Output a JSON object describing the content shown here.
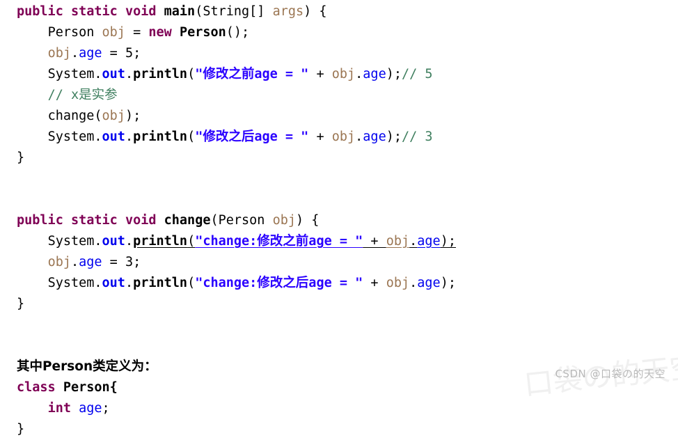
{
  "document": {
    "kind": "java-code-snippet",
    "background_color": "#ffffff"
  },
  "palette": {
    "keyword": "#7f0055",
    "plain": "#000000",
    "local_variable": "#9b7653",
    "field": "#0000ee",
    "string": "#2a00ff",
    "comment": "#3f7f5f",
    "watermark": "#b9b9b9",
    "watermark_faint": "#f0f0f0"
  },
  "code": {
    "lines": [
      {
        "id": "line-1",
        "indent": 0,
        "tokens": [
          {
            "t": "public",
            "c": "kw"
          },
          {
            "t": " ",
            "c": "plain"
          },
          {
            "t": "static",
            "c": "kw"
          },
          {
            "t": " ",
            "c": "plain"
          },
          {
            "t": "void",
            "c": "kw"
          },
          {
            "t": " ",
            "c": "plain"
          },
          {
            "t": "main",
            "c": "plainb"
          },
          {
            "t": "(",
            "c": "plain"
          },
          {
            "t": "String",
            "c": "plain"
          },
          {
            "t": "[] ",
            "c": "plain"
          },
          {
            "t": "args",
            "c": "var"
          },
          {
            "t": ") {",
            "c": "plain"
          }
        ]
      },
      {
        "id": "line-2",
        "indent": 1,
        "tokens": [
          {
            "t": "Person",
            "c": "plain"
          },
          {
            "t": " ",
            "c": "plain"
          },
          {
            "t": "obj",
            "c": "var"
          },
          {
            "t": " = ",
            "c": "plain"
          },
          {
            "t": "new",
            "c": "kw"
          },
          {
            "t": " ",
            "c": "plain"
          },
          {
            "t": "Person",
            "c": "plainb"
          },
          {
            "t": "();",
            "c": "plain"
          }
        ]
      },
      {
        "id": "line-3",
        "indent": 1,
        "tokens": [
          {
            "t": "obj",
            "c": "var"
          },
          {
            "t": ".",
            "c": "plain"
          },
          {
            "t": "age",
            "c": "field"
          },
          {
            "t": " = ",
            "c": "plain"
          },
          {
            "t": "5",
            "c": "plain"
          },
          {
            "t": ";",
            "c": "plain"
          }
        ]
      },
      {
        "id": "line-4",
        "indent": 1,
        "tokens": [
          {
            "t": "System",
            "c": "plain"
          },
          {
            "t": ".",
            "c": "plain"
          },
          {
            "t": "out",
            "c": "fieldb"
          },
          {
            "t": ".",
            "c": "plain"
          },
          {
            "t": "println",
            "c": "plainb"
          },
          {
            "t": "(",
            "c": "plain"
          },
          {
            "t": "\"修改之前age = \"",
            "c": "str"
          },
          {
            "t": " + ",
            "c": "plain"
          },
          {
            "t": "obj",
            "c": "var"
          },
          {
            "t": ".",
            "c": "plain"
          },
          {
            "t": "age",
            "c": "field"
          },
          {
            "t": ");",
            "c": "plain"
          },
          {
            "t": "// 5",
            "c": "cmt"
          }
        ]
      },
      {
        "id": "line-5",
        "indent": 1,
        "tokens": [
          {
            "t": "// x是实参",
            "c": "cmt"
          }
        ]
      },
      {
        "id": "line-6",
        "indent": 1,
        "tokens": [
          {
            "t": "change",
            "c": "plain"
          },
          {
            "t": "(",
            "c": "plain"
          },
          {
            "t": "obj",
            "c": "var"
          },
          {
            "t": ");",
            "c": "plain"
          }
        ]
      },
      {
        "id": "line-7",
        "indent": 1,
        "tokens": [
          {
            "t": "System",
            "c": "plain"
          },
          {
            "t": ".",
            "c": "plain"
          },
          {
            "t": "out",
            "c": "fieldb"
          },
          {
            "t": ".",
            "c": "plain"
          },
          {
            "t": "println",
            "c": "plainb"
          },
          {
            "t": "(",
            "c": "plain"
          },
          {
            "t": "\"修改之后age = \"",
            "c": "str"
          },
          {
            "t": " + ",
            "c": "plain"
          },
          {
            "t": "obj",
            "c": "var"
          },
          {
            "t": ".",
            "c": "plain"
          },
          {
            "t": "age",
            "c": "field"
          },
          {
            "t": ");",
            "c": "plain"
          },
          {
            "t": "// 3",
            "c": "cmt"
          }
        ]
      },
      {
        "id": "line-8",
        "indent": 0,
        "tokens": [
          {
            "t": "}",
            "c": "plain"
          }
        ]
      },
      {
        "id": "line-9",
        "indent": 0,
        "tokens": []
      },
      {
        "id": "line-10",
        "indent": 0,
        "tokens": []
      },
      {
        "id": "line-11",
        "indent": 0,
        "tokens": [
          {
            "t": "public",
            "c": "kw"
          },
          {
            "t": " ",
            "c": "plain"
          },
          {
            "t": "static",
            "c": "kw"
          },
          {
            "t": " ",
            "c": "plain"
          },
          {
            "t": "void",
            "c": "kw"
          },
          {
            "t": " ",
            "c": "plain"
          },
          {
            "t": "change",
            "c": "plainb"
          },
          {
            "t": "(",
            "c": "plain"
          },
          {
            "t": "Person",
            "c": "plain"
          },
          {
            "t": " ",
            "c": "plain"
          },
          {
            "t": "obj",
            "c": "var"
          },
          {
            "t": ") {",
            "c": "plain"
          }
        ]
      },
      {
        "id": "line-12",
        "indent": 1,
        "underline_from": 4,
        "tokens": [
          {
            "t": "System",
            "c": "plain"
          },
          {
            "t": ".",
            "c": "plain"
          },
          {
            "t": "out",
            "c": "fieldb"
          },
          {
            "t": ".",
            "c": "plain"
          },
          {
            "t": "println",
            "c": "plainb"
          },
          {
            "t": "(",
            "c": "plain"
          },
          {
            "t": "\"change:修改之前age = \"",
            "c": "str"
          },
          {
            "t": " + ",
            "c": "plain"
          },
          {
            "t": "obj",
            "c": "var"
          },
          {
            "t": ".",
            "c": "plain"
          },
          {
            "t": "age",
            "c": "field"
          },
          {
            "t": ");",
            "c": "plain"
          }
        ]
      },
      {
        "id": "line-13",
        "indent": 1,
        "tokens": [
          {
            "t": "obj",
            "c": "var"
          },
          {
            "t": ".",
            "c": "plain"
          },
          {
            "t": "age",
            "c": "field"
          },
          {
            "t": " = ",
            "c": "plain"
          },
          {
            "t": "3",
            "c": "plain"
          },
          {
            "t": ";",
            "c": "plain"
          }
        ]
      },
      {
        "id": "line-14",
        "indent": 1,
        "tokens": [
          {
            "t": "System",
            "c": "plain"
          },
          {
            "t": ".",
            "c": "plain"
          },
          {
            "t": "out",
            "c": "fieldb"
          },
          {
            "t": ".",
            "c": "plain"
          },
          {
            "t": "println",
            "c": "plainb"
          },
          {
            "t": "(",
            "c": "plain"
          },
          {
            "t": "\"change:修改之后age = \"",
            "c": "str"
          },
          {
            "t": " + ",
            "c": "plain"
          },
          {
            "t": "obj",
            "c": "var"
          },
          {
            "t": ".",
            "c": "plain"
          },
          {
            "t": "age",
            "c": "field"
          },
          {
            "t": ");",
            "c": "plain"
          }
        ]
      },
      {
        "id": "line-15",
        "indent": 0,
        "tokens": [
          {
            "t": "}",
            "c": "plain"
          }
        ]
      },
      {
        "id": "line-16",
        "indent": 0,
        "tokens": []
      },
      {
        "id": "line-17",
        "indent": 0,
        "tokens": []
      },
      {
        "id": "line-18",
        "indent": 0,
        "prose": true,
        "tokens": [
          {
            "t": "其中Person类定义为：",
            "c": "plainb"
          }
        ]
      },
      {
        "id": "line-19",
        "indent": 0,
        "tokens": [
          {
            "t": "class",
            "c": "kw"
          },
          {
            "t": " ",
            "c": "plain"
          },
          {
            "t": "Person",
            "c": "plainb"
          },
          {
            "t": "{",
            "c": "plainb"
          }
        ]
      },
      {
        "id": "line-20",
        "indent": 1,
        "tokens": [
          {
            "t": "int",
            "c": "kw"
          },
          {
            "t": " ",
            "c": "plain"
          },
          {
            "t": "age",
            "c": "field"
          },
          {
            "t": ";",
            "c": "plain"
          }
        ]
      },
      {
        "id": "line-21",
        "indent": 0,
        "tokens": [
          {
            "t": "}",
            "c": "plain"
          }
        ]
      }
    ]
  },
  "watermark": {
    "small_text": "CSDN @口袋の的天空",
    "large_text": "口袋の的天空"
  }
}
